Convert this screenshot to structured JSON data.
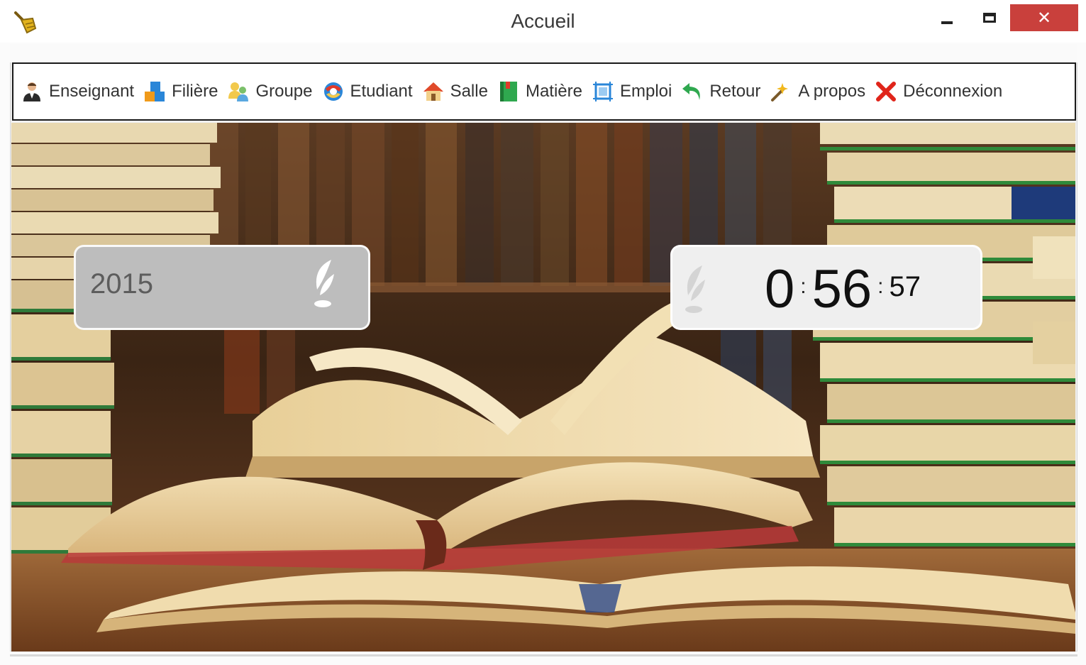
{
  "window": {
    "title": "Accueil",
    "controls": {
      "minimize": "minimize",
      "maximize": "maximize",
      "close": "✕"
    }
  },
  "menu": [
    {
      "id": "enseignant",
      "label": "Enseignant",
      "icon": "teacher-icon"
    },
    {
      "id": "filiere",
      "label": "Filière",
      "icon": "blocks-icon"
    },
    {
      "id": "groupe",
      "label": "Groupe",
      "icon": "group-icon"
    },
    {
      "id": "etudiant",
      "label": "Etudiant",
      "icon": "student-icon"
    },
    {
      "id": "salle",
      "label": "Salle",
      "icon": "house-icon"
    },
    {
      "id": "matiere",
      "label": "Matière",
      "icon": "book-icon"
    },
    {
      "id": "emploi",
      "label": "Emploi",
      "icon": "schedule-icon"
    },
    {
      "id": "retour",
      "label": "Retour",
      "icon": "back-arrow-icon"
    },
    {
      "id": "apropos",
      "label": "A propos",
      "icon": "magic-wand-icon"
    },
    {
      "id": "deconnexion",
      "label": "Déconnexion",
      "icon": "red-x-icon"
    }
  ],
  "widgets": {
    "year": "2015",
    "clock": {
      "hours": "0",
      "minutes": "56",
      "seconds": "57",
      "separator": ":"
    }
  },
  "colors": {
    "close_button": "#c9403c",
    "year_panel": "#bdbdbd",
    "clock_panel": "#efefef"
  }
}
